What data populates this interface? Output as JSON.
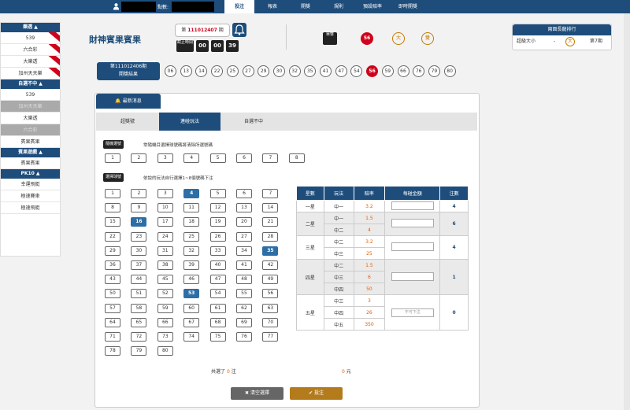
{
  "topbar": {
    "points_label": "點數:",
    "nav": [
      "投注",
      "報表",
      "開獎",
      "規則",
      "預設賠率",
      "即時開獎"
    ]
  },
  "sidebar": {
    "groups": [
      {
        "title": "樂透 ▲",
        "items": [
          {
            "label": "539",
            "ribbon": true,
            "disabled": false
          },
          {
            "label": "六合彩",
            "ribbon": true,
            "disabled": false
          },
          {
            "label": "大樂透",
            "ribbon": true,
            "disabled": false
          },
          {
            "label": "加州天天樂",
            "ribbon": true,
            "disabled": false
          }
        ]
      },
      {
        "title": "自選不中 ▲",
        "items": [
          {
            "label": "539",
            "ribbon": false,
            "disabled": false
          },
          {
            "label": "加州天天樂",
            "ribbon": false,
            "disabled": true
          },
          {
            "label": "大樂透",
            "ribbon": false,
            "disabled": false
          },
          {
            "label": "六合彩",
            "ribbon": false,
            "disabled": true
          },
          {
            "label": "賓果賓果",
            "ribbon": false,
            "disabled": false
          }
        ]
      },
      {
        "title": "賓果遊戲 ▲",
        "items": [
          {
            "label": "賓果賓果",
            "ribbon": false,
            "disabled": false
          }
        ]
      },
      {
        "title": "PK10 ▲",
        "items": [
          {
            "label": "幸運飛艇",
            "ribbon": false,
            "disabled": false
          },
          {
            "label": "極速賽車",
            "ribbon": false,
            "disabled": false
          },
          {
            "label": "極速飛艇",
            "ribbon": false,
            "disabled": false
          }
        ]
      }
    ]
  },
  "header": {
    "game_title": "財神賓果賓果",
    "period_prefix": "第",
    "period_number": "111012407",
    "period_suffix": "期",
    "timer_label": "截止時間",
    "timer": [
      "00",
      "00",
      "39"
    ],
    "result_dark": "單雙",
    "result_red": "56",
    "result_big": "大",
    "result_single": "雙"
  },
  "rank": {
    "title": "兩面長龍排行",
    "row_label": "超級大小",
    "row_dash": "-",
    "row_value": "大",
    "row_count": "第7期"
  },
  "history": {
    "label_line1": "第111012406期",
    "label_line2": "開獎結果",
    "balls": [
      "06",
      "13",
      "14",
      "22",
      "25",
      "27",
      "29",
      "30",
      "32",
      "35",
      "41",
      "47",
      "54",
      "56",
      "59",
      "66",
      "76",
      "79",
      "80"
    ],
    "red_ball": "56"
  },
  "news_tab": "最新消息",
  "subtabs": [
    "超獎號",
    "連碰玩法",
    "自選不中"
  ],
  "active_subtab": "連碰玩法",
  "quick": {
    "tag": "隨機選號",
    "hint": "常隨機目選擇球號碼將清除所選號碼",
    "numbers": [
      "1",
      "2",
      "3",
      "4",
      "5",
      "6",
      "7",
      "8"
    ]
  },
  "select": {
    "tag": "選擇球號",
    "hint": "依說的玩法自行選擇1~8個號碼下注",
    "selected": [
      "4",
      "16",
      "35",
      "53"
    ]
  },
  "odds": {
    "headers": [
      "星數",
      "玩法",
      "賠率",
      "每碰金額",
      "注數"
    ],
    "rows": [
      {
        "star": "一星",
        "plays": [
          {
            "play": "中一",
            "rate": "3.2"
          }
        ],
        "count": "4",
        "input": ""
      },
      {
        "star": "二星",
        "plays": [
          {
            "play": "中一",
            "rate": "1.5"
          },
          {
            "play": "中二",
            "rate": "4"
          }
        ],
        "count": "6",
        "input": ""
      },
      {
        "star": "三星",
        "plays": [
          {
            "play": "中二",
            "rate": "3.2"
          },
          {
            "play": "中三",
            "rate": "25"
          }
        ],
        "count": "4",
        "input": ""
      },
      {
        "star": "四星",
        "plays": [
          {
            "play": "中二",
            "rate": "1.5"
          },
          {
            "play": "中三",
            "rate": "6"
          },
          {
            "play": "中四",
            "rate": "50"
          }
        ],
        "count": "1",
        "input": ""
      },
      {
        "star": "五星",
        "plays": [
          {
            "play": "中三",
            "rate": "3"
          },
          {
            "play": "中四",
            "rate": "26"
          },
          {
            "play": "中五",
            "rate": "350"
          }
        ],
        "count": "0",
        "input": "不可下注"
      }
    ]
  },
  "footer": {
    "total_prefix": "共選了",
    "total_count": "0",
    "total_suffix": "注",
    "amount": "0",
    "amount_unit": "元",
    "clear_label": "清空選擇",
    "submit_label": "投注"
  }
}
